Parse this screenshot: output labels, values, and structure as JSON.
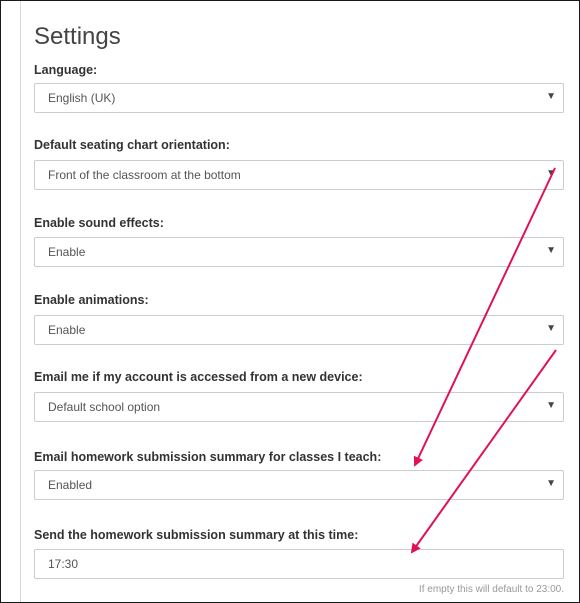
{
  "settings": {
    "title": "Settings",
    "language": {
      "label": "Language:",
      "value": "English (UK)"
    },
    "orientation": {
      "label": "Default seating chart orientation:",
      "value": "Front of the classroom at the bottom"
    },
    "sound": {
      "label": "Enable sound effects:",
      "value": "Enable"
    },
    "animations": {
      "label": "Enable animations:",
      "value": "Enable"
    },
    "new_device": {
      "label": "Email me if my account is accessed from a new device:",
      "value": "Default school option"
    },
    "homework_summary": {
      "label": "Email homework submission summary for classes I teach:",
      "value": "Enabled"
    },
    "summary_time": {
      "label": "Send the homework submission summary at this time:",
      "value": "17:30",
      "hint": "If empty this will default to 23:00."
    }
  },
  "icons": {
    "dropdown_arrow": "triangle-down-icon",
    "glyph": "▼"
  },
  "colors": {
    "annotation_arrow": "#e0105a",
    "border": "#cccccc",
    "frame": "#1a1a1a"
  }
}
